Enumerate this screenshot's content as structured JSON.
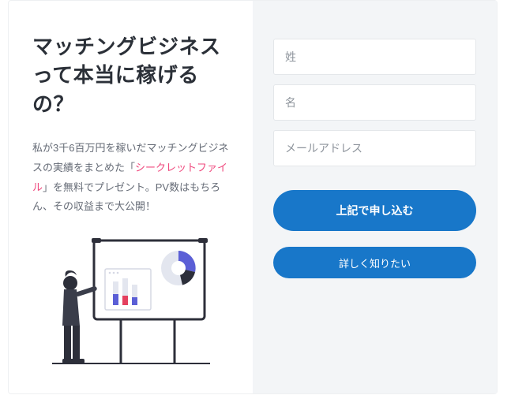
{
  "heading": "マッチングビジネスって本当に稼げるの？",
  "body_parts": {
    "p1": "私が3千6百万円を稼いだマッチングビジネスの実績をまとめた「",
    "highlight": "シークレットファイル",
    "p2": "」を無料でプレゼント。PV数はもちろん、その収益まで大公開！"
  },
  "form": {
    "last_name_placeholder": "姓",
    "first_name_placeholder": "名",
    "email_placeholder": "メールアドレス",
    "submit_label": "上記で申し込む",
    "more_label": "詳しく知りたい"
  },
  "colors": {
    "accent": "#1877c9",
    "highlight": "#ef4a7e",
    "panel_bg": "#f3f5f7"
  }
}
